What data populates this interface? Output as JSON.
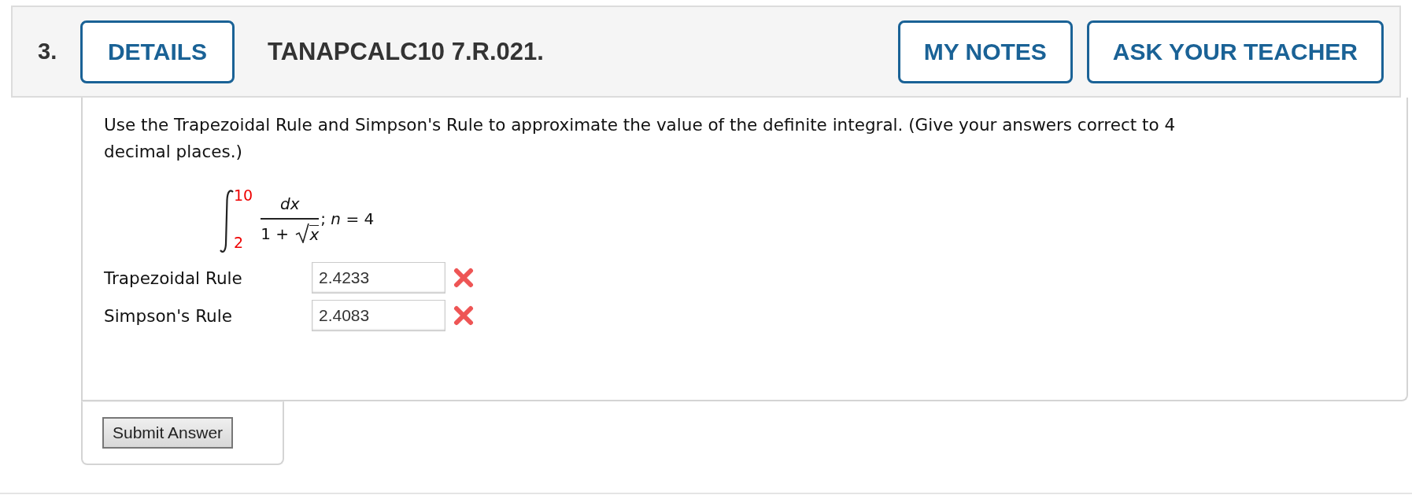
{
  "question": {
    "number": "3.",
    "details_button": "DETAILS",
    "code": "TANAPCALC10 7.R.021.",
    "buttons": [
      "MY NOTES",
      "ASK YOUR TEACHER"
    ]
  },
  "prompt": "Use the Trapezoidal Rule and Simpson's Rule to approximate the value of the definite integral. (Give your answers correct to 4 decimal places.)",
  "integral": {
    "upper": "10",
    "lower": "2",
    "numerator": "dx",
    "denominator": "1 + ",
    "radicand": "x",
    "tail": "; *n* = 4"
  },
  "answers": [
    {
      "label": "Trapezoidal Rule",
      "value": "2.4233",
      "correct": false
    },
    {
      "label": "Simpson's Rule",
      "value": "2.4083",
      "correct": false
    }
  ],
  "submit_button": "Submit Answer"
}
